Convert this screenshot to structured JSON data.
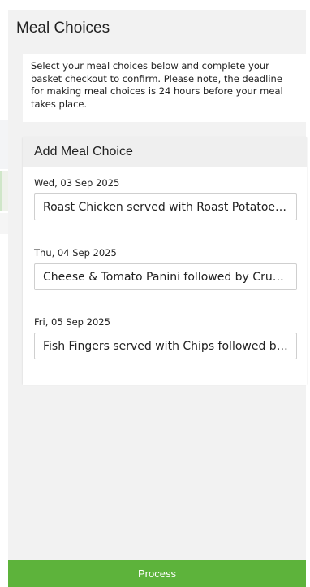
{
  "panel": {
    "title": "Meal Choices",
    "intro": "Select your meal choices below and complete your basket checkout to confirm. Please note, the deadline for making meal choices is 24 hours before your meal takes place."
  },
  "add_meal": {
    "header": "Add Meal Choice",
    "meals": [
      {
        "date": "Wed, 03 Sep 2025",
        "choice": "Roast Chicken served with Roast Potatoes…"
      },
      {
        "date": "Thu, 04 Sep 2025",
        "choice": "Cheese & Tomato Panini followed by Crunc…"
      },
      {
        "date": "Fri, 05 Sep 2025",
        "choice": "Fish Fingers served with Chips followed by…"
      }
    ]
  },
  "footer": {
    "process_label": "Process"
  },
  "colors": {
    "accent": "#5db33b",
    "panel_bg": "#f2f2f2"
  }
}
